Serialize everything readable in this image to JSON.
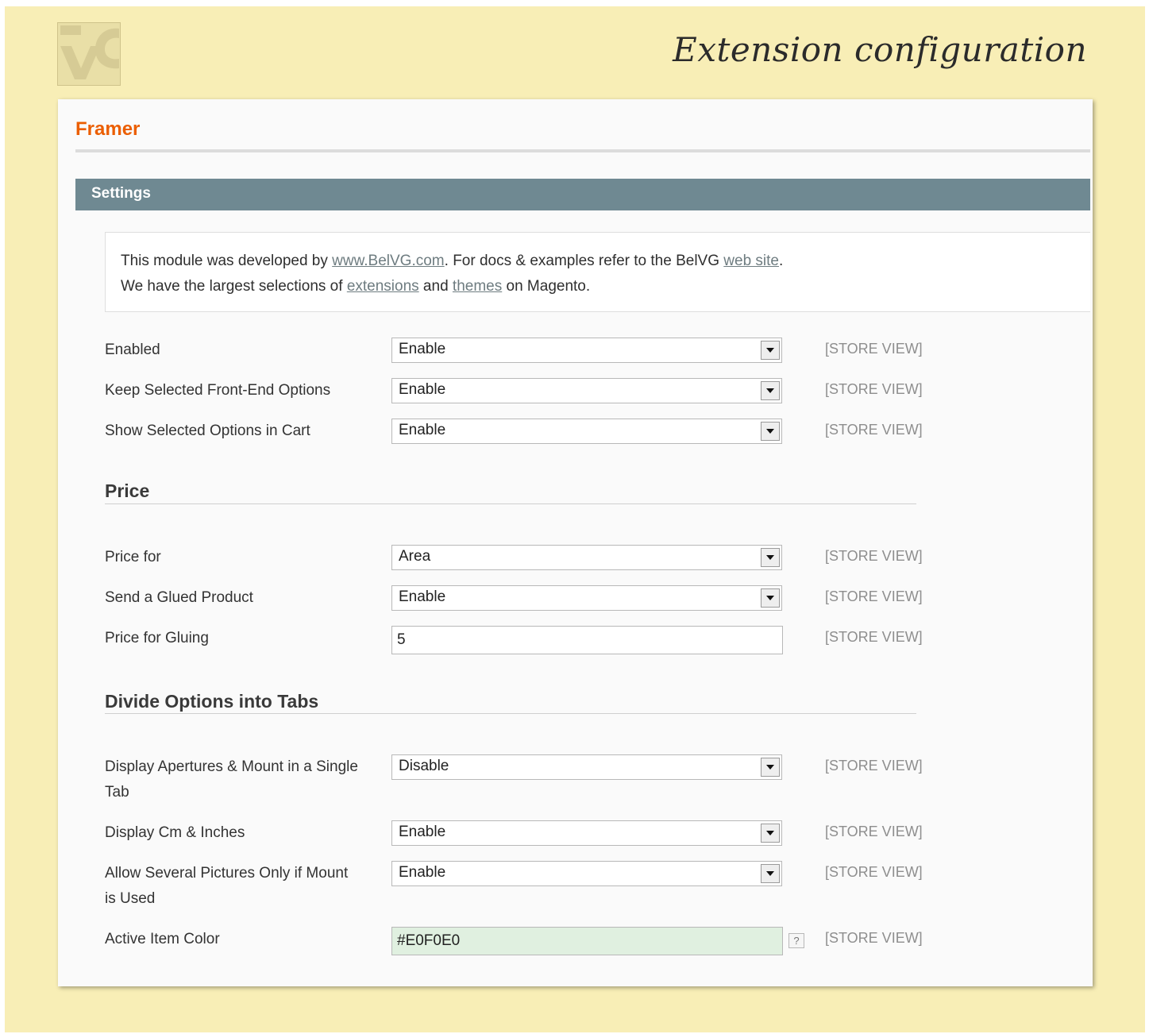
{
  "header": {
    "title": "Extension configuration"
  },
  "panel": {
    "title": "Framer",
    "section": "Settings",
    "comment": {
      "line1_prefix": "This module was developed by ",
      "link_belvg": "www.BelVG.com",
      "line1_middle": ". For docs & examples refer to the BelVG ",
      "link_website": "web site",
      "line1_suffix": ".",
      "line2_prefix": "We have the largest selections of ",
      "link_extensions": "extensions",
      "line2_middle": " and ",
      "link_themes": "themes",
      "line2_suffix": " on Magento."
    }
  },
  "scope_label": "[STORE VIEW]",
  "general": [
    {
      "label": "Enabled",
      "value": "Enable"
    },
    {
      "label": "Keep Selected Front-End Options",
      "value": "Enable"
    },
    {
      "label": "Show Selected Options in Cart",
      "value": "Enable"
    }
  ],
  "price": {
    "title": "Price",
    "rows": [
      {
        "label": "Price for",
        "value": "Area"
      },
      {
        "label": "Send a Glued Product",
        "value": "Enable"
      },
      {
        "label": "Price for Gluing",
        "value": "5"
      }
    ]
  },
  "tabs": {
    "title": "Divide Options into Tabs",
    "rows": [
      {
        "label": "Display Apertures & Mount in a Single Tab",
        "value": "Disable"
      },
      {
        "label": "Display Cm & Inches",
        "value": "Enable"
      },
      {
        "label": "Allow Several Pictures Only if Mount is Used",
        "value": "Enable"
      },
      {
        "label": "Active Item Color",
        "value": "#E0F0E0"
      }
    ],
    "help_icon": "?"
  },
  "colors": {
    "page_background": "#f8eeb6",
    "accent": "#eb5e00",
    "section_header": "#6f8992",
    "active_item_color": "#E0F0E0"
  }
}
